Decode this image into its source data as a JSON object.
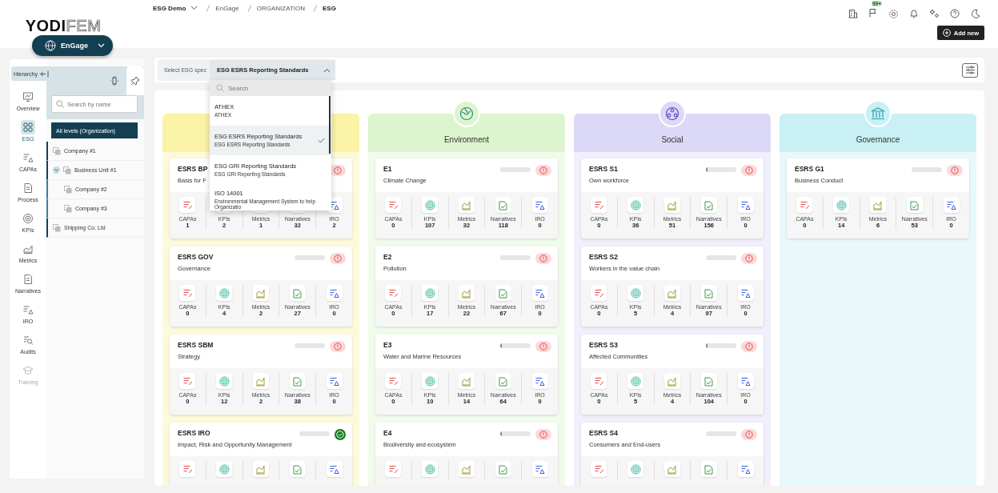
{
  "logo": {
    "bold": "YODI",
    "light": "FEM"
  },
  "app_switcher": {
    "label": "EnGage"
  },
  "breadcrumb": {
    "workspace": "ESG Demo",
    "items": [
      "EnGage",
      "ORGANIZATION",
      "ESG"
    ]
  },
  "header": {
    "badge": "99+",
    "add_button": "Add new"
  },
  "nav": [
    {
      "kind": "overview",
      "label": "Overview",
      "selected": false,
      "disabled": false
    },
    {
      "kind": "esg",
      "label": "ESG",
      "selected": true,
      "disabled": false
    },
    {
      "kind": "capas",
      "label": "CAPAs",
      "selected": false,
      "disabled": false
    },
    {
      "kind": "process",
      "label": "Process",
      "selected": false,
      "disabled": false
    },
    {
      "kind": "kpis",
      "label": "KPIs",
      "selected": false,
      "disabled": false
    },
    {
      "kind": "metrics",
      "label": "Metrics",
      "selected": false,
      "disabled": false
    },
    {
      "kind": "narratives",
      "label": "Narratives",
      "selected": false,
      "disabled": false
    },
    {
      "kind": "iro",
      "label": "IRO",
      "selected": false,
      "disabled": false
    },
    {
      "kind": "audits",
      "label": "Audits",
      "selected": false,
      "disabled": false
    },
    {
      "kind": "training",
      "label": "Training",
      "selected": false,
      "disabled": true
    }
  ],
  "hierarchy": {
    "title": "Hierarchy",
    "search": {
      "placeholder": "Search by name"
    },
    "all_levels": "All levels (Organization)",
    "tree": [
      {
        "label": "Company #1"
      },
      {
        "label": "Business Unit #1",
        "expanded": true,
        "children": [
          {
            "label": "Company #2"
          },
          {
            "label": "Company #3"
          }
        ]
      },
      {
        "label": "Shipping Co. Ltd"
      }
    ]
  },
  "spec_select": {
    "label": "Select ESG spec",
    "value": "ESG ESRS Reporting Standards",
    "expanded": true,
    "search": {
      "placeholder": "Search"
    },
    "options": [
      {
        "title": "ATHEX",
        "subtitle": "ATHEX",
        "selected": false
      },
      {
        "title": "ESG ESRS Reporting Standards",
        "subtitle": "ESG ESRS Reporting Standards",
        "selected": true
      },
      {
        "title": "ESG GRI Reporting Standards",
        "subtitle": "ESG GRI Reporting Standards",
        "selected": false
      },
      {
        "title": "ISO 14001",
        "subtitle": "Environmental Management System to help Organizatio",
        "selected": false
      }
    ]
  },
  "columns": [
    {
      "color": "#fbf3a6",
      "cards": [
        {
          "code": "ESRS BP",
          "name": "Basis for F",
          "complete": false,
          "stats": [
            {
              "kind": "capas",
              "label": "CAPAs",
              "value": "1"
            },
            {
              "kind": "kpis",
              "label": "KPIs",
              "value": "2"
            },
            {
              "kind": "metrics",
              "label": "Metrics",
              "value": "1"
            },
            {
              "kind": "narratives",
              "label": "Narratives",
              "value": "32"
            },
            {
              "kind": "iro",
              "label": "IRO",
              "value": "2"
            }
          ]
        },
        {
          "code": "ESRS GOV",
          "name": "Governance",
          "complete": false,
          "stats": [
            {
              "kind": "capas",
              "label": "CAPAs",
              "value": "0"
            },
            {
              "kind": "kpis",
              "label": "KPIs",
              "value": "4"
            },
            {
              "kind": "metrics",
              "label": "Metrics",
              "value": "2"
            },
            {
              "kind": "narratives",
              "label": "Narratives",
              "value": "27"
            },
            {
              "kind": "iro",
              "label": "IRO",
              "value": "0"
            }
          ]
        },
        {
          "code": "ESRS SBM",
          "name": "Strategy",
          "complete": false,
          "stats": [
            {
              "kind": "capas",
              "label": "CAPAs",
              "value": "0"
            },
            {
              "kind": "kpis",
              "label": "KPIs",
              "value": "12"
            },
            {
              "kind": "metrics",
              "label": "Metrics",
              "value": "2"
            },
            {
              "kind": "narratives",
              "label": "Narratives",
              "value": "38"
            },
            {
              "kind": "iro",
              "label": "IRO",
              "value": "0"
            }
          ]
        },
        {
          "code": "ESRS IRO",
          "name": "Impact, Risk and Opportunity Management",
          "complete": true,
          "stats": [
            {
              "kind": "capas"
            },
            {
              "kind": "kpis"
            },
            {
              "kind": "metrics"
            },
            {
              "kind": "narratives"
            },
            {
              "kind": "iro"
            }
          ]
        }
      ]
    },
    {
      "title": "Environment",
      "kind": "environment",
      "color": "#dcf5cf",
      "cards": [
        {
          "code": "E1",
          "name": "Climate Change",
          "complete": false,
          "stats": [
            {
              "kind": "capas",
              "label": "CAPAs",
              "value": "0"
            },
            {
              "kind": "kpis",
              "label": "KPIs",
              "value": "107"
            },
            {
              "kind": "metrics",
              "label": "Metrics",
              "value": "32"
            },
            {
              "kind": "narratives",
              "label": "Narratives",
              "value": "118"
            },
            {
              "kind": "iro",
              "label": "IRO",
              "value": "0"
            }
          ]
        },
        {
          "code": "E2",
          "name": "Pollution",
          "complete": false,
          "stats": [
            {
              "kind": "capas",
              "label": "CAPAs",
              "value": "0"
            },
            {
              "kind": "kpis",
              "label": "KPIs",
              "value": "17"
            },
            {
              "kind": "metrics",
              "label": "Metrics",
              "value": "22"
            },
            {
              "kind": "narratives",
              "label": "Narratives",
              "value": "67"
            },
            {
              "kind": "iro",
              "label": "IRO",
              "value": "0"
            }
          ]
        },
        {
          "code": "E3",
          "name": "Water and Marine Resources",
          "level": 0.06,
          "complete": false,
          "stats": [
            {
              "kind": "capas",
              "label": "CAPAs",
              "value": "0"
            },
            {
              "kind": "kpis",
              "label": "KPIs",
              "value": "10"
            },
            {
              "kind": "metrics",
              "label": "Metrics",
              "value": "14"
            },
            {
              "kind": "narratives",
              "label": "Narratives",
              "value": "64"
            },
            {
              "kind": "iro",
              "label": "IRO",
              "value": "0"
            }
          ]
        },
        {
          "code": "E4",
          "name": "Biodiversity and ecosystem",
          "level": 0.06,
          "complete": false,
          "stats": [
            {
              "kind": "capas"
            },
            {
              "kind": "kpis"
            },
            {
              "kind": "metrics"
            },
            {
              "kind": "narratives"
            },
            {
              "kind": "iro"
            }
          ]
        }
      ]
    },
    {
      "title": "Social",
      "kind": "social",
      "color": "#dcd8f7",
      "cards": [
        {
          "code": "ESRS S1",
          "name": "Own workforce",
          "level": 0.06,
          "complete": false,
          "stats": [
            {
              "kind": "capas",
              "label": "CAPAs",
              "value": "0"
            },
            {
              "kind": "kpis",
              "label": "KPIs",
              "value": "36"
            },
            {
              "kind": "metrics",
              "label": "Metrics",
              "value": "51"
            },
            {
              "kind": "narratives",
              "label": "Narratives",
              "value": "156"
            },
            {
              "kind": "iro",
              "label": "IRO",
              "value": "0"
            }
          ]
        },
        {
          "code": "ESRS S2",
          "name": "Workers in the value chain",
          "complete": false,
          "stats": [
            {
              "kind": "capas",
              "label": "CAPAs",
              "value": "0"
            },
            {
              "kind": "kpis",
              "label": "KPIs",
              "value": "5"
            },
            {
              "kind": "metrics",
              "label": "Metrics",
              "value": "4"
            },
            {
              "kind": "narratives",
              "label": "Narratives",
              "value": "97"
            },
            {
              "kind": "iro",
              "label": "IRO",
              "value": "0"
            }
          ]
        },
        {
          "code": "ESRS S3",
          "name": "Affected Communities",
          "level": 0.06,
          "complete": false,
          "stats": [
            {
              "kind": "capas",
              "label": "CAPAs",
              "value": "0"
            },
            {
              "kind": "kpis",
              "label": "KPIs",
              "value": "5"
            },
            {
              "kind": "metrics",
              "label": "Metrics",
              "value": "4"
            },
            {
              "kind": "narratives",
              "label": "Narratives",
              "value": "104"
            },
            {
              "kind": "iro",
              "label": "IRO",
              "value": "0"
            }
          ]
        },
        {
          "code": "ESRS S4",
          "name": "Consumers and End-users",
          "complete": false,
          "stats": [
            {
              "kind": "capas"
            },
            {
              "kind": "kpis"
            },
            {
              "kind": "metrics"
            },
            {
              "kind": "narratives"
            },
            {
              "kind": "iro"
            }
          ]
        }
      ]
    },
    {
      "title": "Governance",
      "kind": "governance",
      "color": "#c9f0f4",
      "cards": [
        {
          "code": "ESRS G1",
          "name": "Business Conduct",
          "complete": false,
          "stats": [
            {
              "kind": "capas",
              "label": "CAPAs",
              "value": "0"
            },
            {
              "kind": "kpis",
              "label": "KPIs",
              "value": "14"
            },
            {
              "kind": "metrics",
              "label": "Metrics",
              "value": "6"
            },
            {
              "kind": "narratives",
              "label": "Narratives",
              "value": "53"
            },
            {
              "kind": "iro",
              "label": "IRO",
              "value": "0"
            }
          ]
        }
      ]
    }
  ]
}
